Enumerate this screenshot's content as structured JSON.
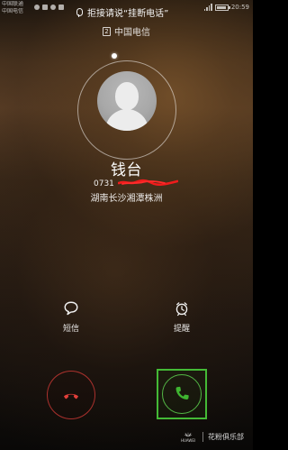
{
  "status_bar": {
    "carrier_lines": [
      "中国联通",
      "中国电信"
    ],
    "time": "20:59"
  },
  "call": {
    "voice_hint": "拒接请说“挂断电话”",
    "sim_slot": "2",
    "carrier": "中国电信",
    "contact_name": "钱台",
    "phone_prefix": "0731",
    "location": "湖南长沙湘潭株洲"
  },
  "actions": {
    "sms_label": "短信",
    "reminder_label": "提醒"
  },
  "watermark": {
    "logo_text": "HUAWEI",
    "text": "花粉俱乐部"
  },
  "colors": {
    "decline_red": "#e23f3a",
    "answer_green": "#44b936",
    "background_brown": "#5e4128"
  },
  "icons": {
    "microphone": "mic-icon",
    "sim": "sim-card-icon",
    "sms": "message-bubble-icon",
    "reminder": "alarm-clock-icon",
    "decline": "hang-up-phone-icon",
    "answer": "phone-handset-icon"
  }
}
